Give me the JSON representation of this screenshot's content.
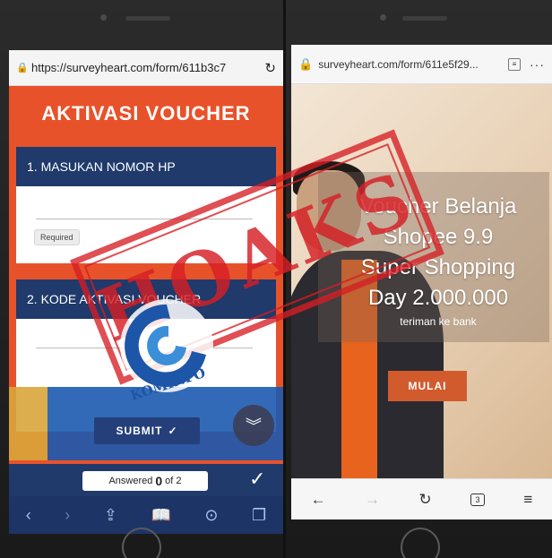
{
  "left_phone": {
    "url": "https://surveyheart.com/form/611b3c7",
    "form_title": "AKTIVASI VOUCHER",
    "questions": [
      {
        "label": "1. MASUKAN NOMOR HP",
        "badge": "Required"
      },
      {
        "label": "2. KODE AKTIVASI VOUCHER"
      }
    ],
    "submit_label": "SUBMIT",
    "answered_prefix": "Answered",
    "answered_count": "0",
    "answered_suffix": "of 2",
    "colors": {
      "brand_orange": "#e8522a",
      "navy": "#1f3a6b"
    }
  },
  "right_phone": {
    "url": "surveyheart.com/form/611e5f29...",
    "voucher_lines": [
      "Voucher Belanja",
      "Shopee 9.9",
      "Super Shopping",
      "Day 2.000.000"
    ],
    "subtitle": "teriman ke bank",
    "button_label": "MULAI",
    "tab_count": "3",
    "colors": {
      "button": "#d25b2e"
    }
  },
  "overlay": {
    "stamp_text": "HOAKS",
    "logo_text": "KOMINFO",
    "stamp_color": "#d61e24"
  },
  "icons": {
    "lock": "lock-icon",
    "reload": "reload-icon",
    "chevron_down": "double-chevron-down-icon",
    "check": "check-icon",
    "back": "back-arrow-icon",
    "forward": "forward-arrow-icon",
    "share": "share-icon",
    "bookmarks": "bookmarks-icon",
    "download": "download-icon",
    "tabs": "tabs-icon",
    "menu": "menu-icon"
  }
}
